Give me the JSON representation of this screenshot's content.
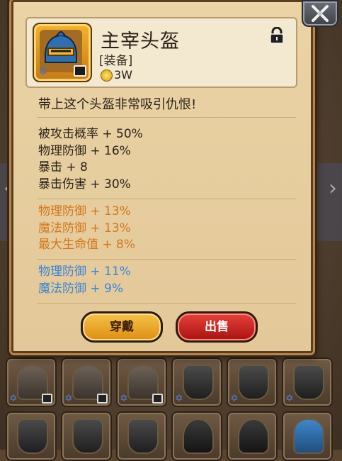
{
  "item": {
    "name": "主宰头盔",
    "type": "[装备]",
    "price": "3W",
    "description": "带上这个头盔非常吸引仇恨!"
  },
  "stats_base": [
    "被攻击概率 + 50%",
    "物理防御 + 16%",
    "暴击 + 8",
    "暴击伤害 + 30%"
  ],
  "stats_orange": [
    "物理防御 + 13%",
    "魔法防御 + 13%",
    "最大生命值 + 8%"
  ],
  "stats_blue": [
    "物理防御 + 11%",
    "魔法防御 + 9%"
  ],
  "buttons": {
    "equip": "穿戴",
    "sell": "出售"
  },
  "colors": {
    "orange_stat": "#d3771d",
    "blue_stat": "#3b84d6",
    "equip_button": "#f0b02e",
    "sell_button": "#d42a25"
  },
  "icons": {
    "close": "crossed-swords-icon",
    "lock": "padlock-icon",
    "coin": "gold-coin-icon",
    "star": "star-of-david-icon"
  }
}
